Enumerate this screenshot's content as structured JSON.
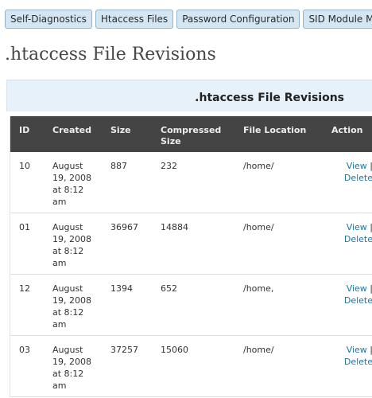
{
  "tabs": [
    "Self-Diagnostics",
    "Htaccess Files",
    "Password Configuration",
    "SID Module Ma"
  ],
  "page_title": ".htaccess File Revisions",
  "panel_title": ".htaccess File Revisions",
  "table": {
    "headers": {
      "id": "ID",
      "created": "Created",
      "size": "Size",
      "compressed_line1": "Compressed",
      "compressed_line2": "Size",
      "location": "File Location",
      "action": "Action"
    },
    "rows": [
      {
        "id": "10",
        "created": [
          "August",
          "19, 2008",
          "at 8:12",
          "am"
        ],
        "size": "887",
        "compressed": "232",
        "location": "/home/",
        "view": "View",
        "sep": " |",
        "delete": "Delete"
      },
      {
        "id": "01",
        "created": [
          "August",
          "19, 2008",
          "at 8:12",
          "am"
        ],
        "size": "36967",
        "compressed": "14884",
        "location": "/home/",
        "view": "View",
        "sep": " |",
        "delete": "Delete"
      },
      {
        "id": "12",
        "created": [
          "August",
          "19, 2008",
          "at 8:12",
          "am"
        ],
        "size": "1394",
        "compressed": "652",
        "location": "/home,",
        "view": "View",
        "sep": " |",
        "delete": "Delete"
      },
      {
        "id": "03",
        "created": [
          "August",
          "19, 2008",
          "at 8:12",
          "am"
        ],
        "size": "37257",
        "compressed": "15060",
        "location": "/home/",
        "view": "View",
        "sep": " |",
        "delete": "Delete"
      }
    ]
  }
}
